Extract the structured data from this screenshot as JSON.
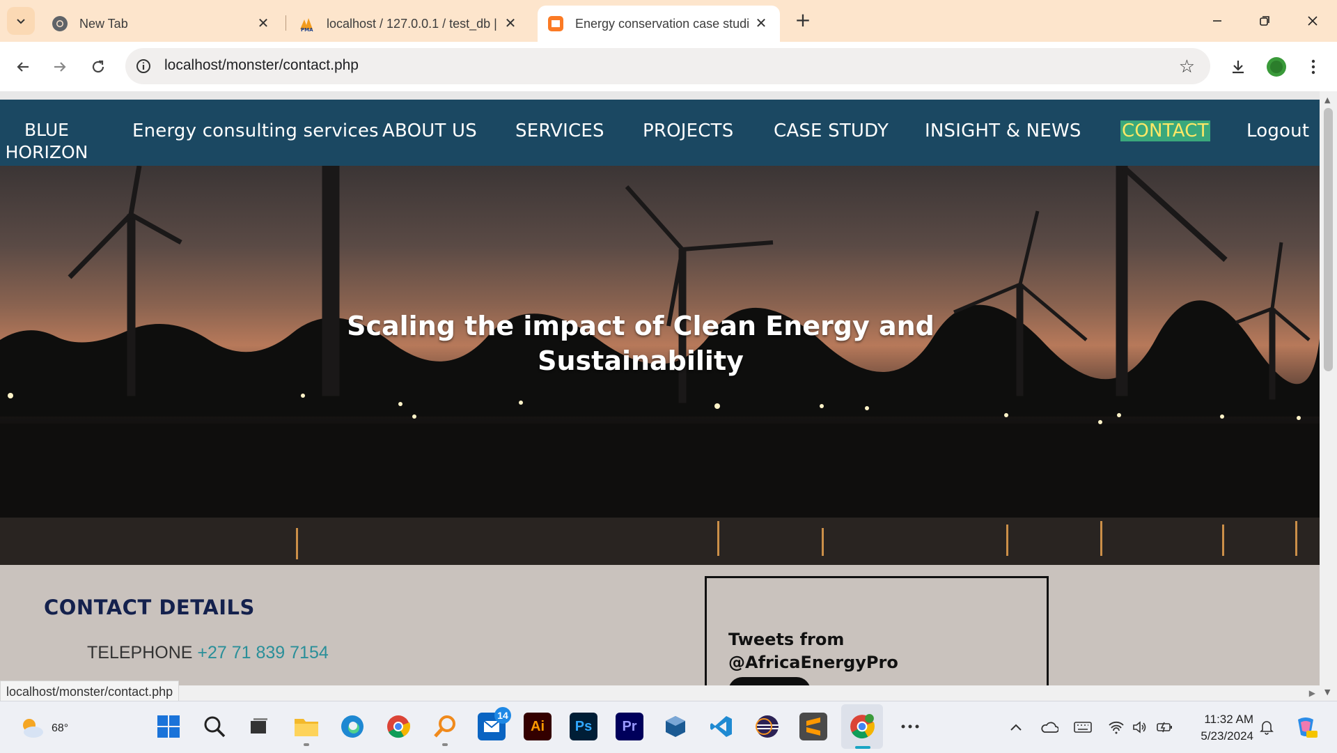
{
  "browser": {
    "tabs": [
      {
        "title": "New Tab",
        "icon": "chrome-icon",
        "active": false
      },
      {
        "title": "localhost / 127.0.0.1 / test_db | ",
        "icon": "phpmyadmin-icon",
        "active": false
      },
      {
        "title": "Energy conservation case studie",
        "icon": "xampp-icon",
        "active": true
      }
    ],
    "url": "localhost/monster/contact.php",
    "status_url": "localhost/monster/contact.php"
  },
  "site": {
    "brand_line1": "BLUE",
    "brand_line2": "HORIZON",
    "nav": [
      {
        "label": "Energy consulting services"
      },
      {
        "label": "ABOUT US"
      },
      {
        "label": "SERVICES"
      },
      {
        "label": "PROJECTS"
      },
      {
        "label": "CASE STUDY"
      },
      {
        "label": "INSIGHT & NEWS"
      },
      {
        "label": "CONTACT",
        "active": true
      },
      {
        "label": "Logout"
      }
    ],
    "active_nav_color": "#3aa87c",
    "nav_bg_color": "#1b4862",
    "hero_title": "Scaling the impact of Clean Energy and Sustainability",
    "contact": {
      "heading": "CONTACT DETAILS",
      "telephone_label": "TELEPHONE",
      "telephone_value": "+27 71 839 7154"
    },
    "tweets": {
      "title_line1": "Tweets from",
      "title_line2": "@AfricaEnergyPro"
    }
  },
  "taskbar": {
    "weather_temp": "68°",
    "teams_badge": "14",
    "time": "11:32 AM",
    "date": "5/23/2024",
    "apps": [
      "start-icon",
      "search-icon",
      "task-view-icon",
      "file-explorer-icon",
      "edge-icon",
      "chrome-icon",
      "search-app-icon",
      "outlook-icon",
      "illustrator-icon",
      "photoshop-icon",
      "premiere-icon",
      "virtualbox-icon",
      "vscode-icon",
      "eclipse-icon",
      "sublime-icon",
      "chrome-active-icon",
      "more-icon"
    ],
    "app_labels": {
      "illustrator": "Ai",
      "photoshop": "Ps",
      "premiere": "Pr"
    }
  }
}
